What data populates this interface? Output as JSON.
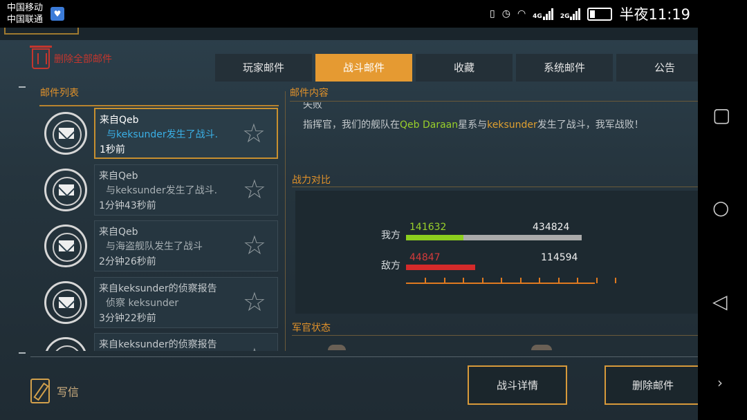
{
  "status_bar": {
    "carrier_1": "中国移动",
    "carrier_2": "中国联通",
    "net_1": "4G",
    "net_2": "2G",
    "time": "半夜11:19"
  },
  "toolbar": {
    "delete_all_label": "删除全部邮件"
  },
  "tabs": [
    {
      "label": "玩家邮件",
      "active": false
    },
    {
      "label": "战斗邮件",
      "active": true
    },
    {
      "label": "收藏",
      "active": false
    },
    {
      "label": "系统邮件",
      "active": false
    },
    {
      "label": "公告",
      "active": false
    }
  ],
  "mail_list": {
    "title": "邮件列表",
    "items": [
      {
        "from": "来自Qeb",
        "subject": "与keksunder发生了战斗.",
        "time": "1秒前",
        "selected": true
      },
      {
        "from": "来自Qeb",
        "subject": "与keksunder发生了战斗.",
        "time": "1分钟43秒前",
        "selected": false
      },
      {
        "from": "来自Qeb",
        "subject": "与海盗舰队发生了战斗",
        "time": "2分钟26秒前",
        "selected": false
      },
      {
        "from": "来自keksunder的侦察报告",
        "subject": "侦察 keksunder",
        "time": "3分钟22秒前",
        "selected": false
      },
      {
        "from": "来自keksunder的侦察报告",
        "subject": "",
        "time": "",
        "selected": false
      }
    ]
  },
  "mail_content": {
    "title": "邮件内容",
    "result_partial": "失败",
    "body_prefix": "指挥官，我们的舰队在",
    "system_name": "Qeb Daraan",
    "body_mid": "星系与",
    "enemy_name": "keksunder",
    "body_suffix": "发生了战斗，我军战败！"
  },
  "power_compare": {
    "title": "战力对比",
    "ours": {
      "label": "我方",
      "current": "141632",
      "max": "434824",
      "fraction": 0.326
    },
    "enemy": {
      "label": "敌方",
      "current": "44847",
      "max": "114594",
      "fraction": 0.391
    },
    "colors": {
      "ours": "#8ccf1e",
      "ours_rest": "#aaaaaa",
      "enemy": "#d42a2a",
      "axis": "#e07a20"
    }
  },
  "officer_status": {
    "title": "军官状态"
  },
  "bottom": {
    "write_label": "写信",
    "battle_detail_label": "战斗详情",
    "delete_mail_label": "删除邮件"
  },
  "icons": {
    "trash": "trash-icon",
    "star": "star-icon",
    "mail": "envelope-icon",
    "pen": "pen-icon"
  },
  "accent_color": "#e59a32"
}
